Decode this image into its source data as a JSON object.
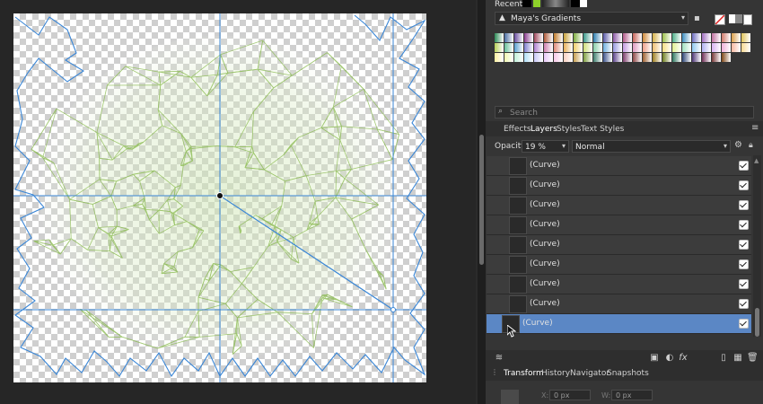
{
  "recent": {
    "label": "Recent:"
  },
  "gradients": {
    "category": "Maya's Gradients"
  },
  "swatch_colors": [
    "#2e8b57",
    "#4b6fa3",
    "#6a4fa0",
    "#8a3d8f",
    "#a24a5f",
    "#b05a3a",
    "#c07a2a",
    "#c9a23a",
    "#7fae3f",
    "#3c9a8a",
    "#2f7fb0",
    "#5a5aa8",
    "#8e5aa8",
    "#b35a8a",
    "#c8645a",
    "#d08a3a",
    "#d6b24a",
    "#9cc04a",
    "#4fb08a",
    "#3e8ec0",
    "#6e6ec0",
    "#a06ec0",
    "#c070a0",
    "#d07a6a",
    "#dba04a",
    "#e0c45a",
    "#b8d05a",
    "#6ac09a",
    "#5aa0d0",
    "#8080d0",
    "#b080d0",
    "#d080b0",
    "#e08a7a",
    "#e8b05a",
    "#f0d06a",
    "#cfe07a",
    "#88d0aa",
    "#70b0e0",
    "#9a9ae0",
    "#c49ae0",
    "#e09ac0",
    "#f0a08a",
    "#f0c070",
    "#f6e080",
    "#e0f090",
    "#a0e0c0",
    "#90c8f0",
    "#b0b0f0",
    "#d8b0f0",
    "#f0b0d8",
    "#f8b8a0",
    "#f8d890",
    "#fcf0a0",
    "#f0f8b0",
    "#c0f0d8",
    "#b0e0f8",
    "#c8c8f8",
    "#e8c8f8",
    "#f8c8e8",
    "#fcd0c0",
    "#c8a050",
    "#80a040",
    "#408070",
    "#405890",
    "#604890",
    "#804070",
    "#904848",
    "#a06030",
    "#a08020",
    "#708020",
    "#307860",
    "#304878",
    "#503878",
    "#703058",
    "#783838",
    "#804818"
  ],
  "search": {
    "placeholder": "Search"
  },
  "tabs": [
    "Effects",
    "Layers",
    "Styles",
    "Text Styles"
  ],
  "opacity": {
    "label": "Opacity:",
    "value": "19 %"
  },
  "blend": {
    "value": "Normal"
  },
  "layers": [
    "(Curve)",
    "(Curve)",
    "(Curve)",
    "(Curve)",
    "(Curve)",
    "(Curve)",
    "(Curve)",
    "(Curve)",
    "(Curve)"
  ],
  "bottom_tabs": [
    "Transform",
    "History",
    "Navigator",
    "Snapshots"
  ],
  "transform": {
    "x_label": "X:",
    "x_value": "0 px",
    "w_label": "W:",
    "w_value": "0 px"
  },
  "icons": {
    "gradient_category": "triangle-icon",
    "dropdown": "chevron-down-icon",
    "menu": "hamburger-icon",
    "settings": "gear-icon",
    "lock": "lock-icon",
    "search": "search-icon",
    "layers_panel": "layers-stack-icon",
    "mask": "mask-icon",
    "adjustment": "adjustment-icon",
    "fx": "fx-icon",
    "add_layer": "page-icon",
    "group": "group-icon",
    "delete": "trash-icon"
  },
  "colors": {
    "selection": "#5b87c5",
    "guide": "#3a86d6",
    "mesh": "#86b84a"
  }
}
